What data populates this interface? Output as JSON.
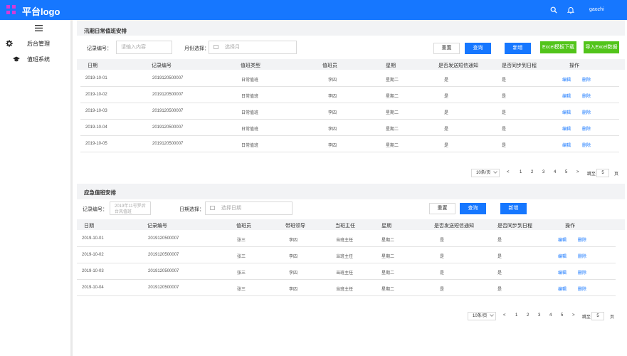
{
  "header": {
    "logo_text": "平台logo",
    "user_name": "gaozhi",
    "icons": [
      "search-icon",
      "bell-icon"
    ],
    "brand_color": "#1677ff"
  },
  "sidebar": {
    "items": [
      {
        "label": "后台管理",
        "icon": "gear-icon"
      },
      {
        "label": "值班系统",
        "icon": "graduation-cap-icon"
      }
    ]
  },
  "flood": {
    "title": "汛期日常值班安排",
    "filters": {
      "record_label": "记录编号：",
      "record_placeholder": "请输入内容",
      "month_label": "月份选择：",
      "month_placeholder": "选择月"
    },
    "buttons": {
      "reset": "重置",
      "query": "查询",
      "add": "新增",
      "excel_template": "Excel模板下载",
      "excel_import": "导入Excel数据"
    },
    "columns": [
      "日期",
      "记录编号",
      "值班类型",
      "值班员",
      "星期",
      "是否发送短信通知",
      "是否同步到日程",
      "操作"
    ],
    "rows": [
      [
        "2019-10-01",
        "2019120500007",
        "日常值班",
        "李四",
        "星期二",
        "是",
        "是"
      ],
      [
        "2019-10-02",
        "2019120500007",
        "日常值班",
        "李四",
        "星期二",
        "是",
        "是"
      ],
      [
        "2019-10-03",
        "2019120500007",
        "日常值班",
        "李四",
        "星期二",
        "是",
        "是"
      ],
      [
        "2019-10-04",
        "2019120500007",
        "日常值班",
        "李四",
        "星期二",
        "是",
        "是"
      ],
      [
        "2019-10-05",
        "2019120500007",
        "日常值班",
        "李四",
        "星期二",
        "是",
        "是"
      ]
    ],
    "edit": "编辑",
    "delete": "删除",
    "pagination": {
      "size": "10条/页",
      "prev": "<",
      "pages": [
        "1",
        "2",
        "3",
        "4",
        "5"
      ],
      "next": ">",
      "jump_label": "跳至",
      "jump_value": "5",
      "page_suffix": "页"
    }
  },
  "emergency": {
    "title": "应急值班安排",
    "filters": {
      "record_label": "记录编号：",
      "record_value": "2019年11号罗后台风值班",
      "date_label": "日期选择：",
      "date_placeholder": "选择日期"
    },
    "buttons": {
      "reset": "重置",
      "query": "查询",
      "add": "新增"
    },
    "columns": [
      "日期",
      "记录编号",
      "值班员",
      "带班领导",
      "当班主任",
      "星期",
      "是否发送短信通知",
      "是否同步到日程",
      "操作"
    ],
    "rows": [
      [
        "2019-10-01",
        "2019120500007",
        "张三",
        "李四",
        "当班主任",
        "星期二",
        "是",
        "是"
      ],
      [
        "2019-10-02",
        "2019120500007",
        "张三",
        "李四",
        "当班主任",
        "星期二",
        "是",
        "是"
      ],
      [
        "2019-10-03",
        "2019120500007",
        "张三",
        "李四",
        "当班主任",
        "星期二",
        "是",
        "是"
      ],
      [
        "2019-10-04",
        "2019120500007",
        "张三",
        "李四",
        "当班主任",
        "星期二",
        "是",
        "是"
      ]
    ],
    "edit": "编辑",
    "delete": "删除",
    "pagination": {
      "size": "10条/页",
      "prev": "<",
      "pages": [
        "1",
        "2",
        "3",
        "4",
        "5"
      ],
      "next": ">",
      "jump_label": "跳至",
      "jump_value": "5",
      "page_suffix": "页"
    }
  }
}
